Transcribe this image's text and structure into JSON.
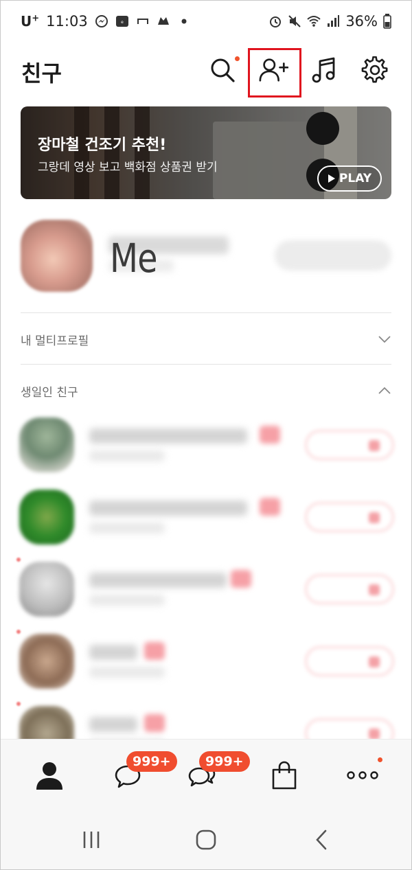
{
  "status_bar": {
    "carrier": "U",
    "carrier_sup": "+",
    "time": "11:03",
    "battery_percent": "36%",
    "icons_left": [
      "messenger-icon",
      "emart-icon",
      "screen-icon",
      "game-icon",
      "dot-icon"
    ],
    "icons_right": [
      "alarm-icon",
      "mute-icon",
      "wifi-icon",
      "signal-icon",
      "battery-icon"
    ]
  },
  "header": {
    "title": "친구",
    "icons": [
      "search-icon",
      "add-friend-icon",
      "music-icon",
      "settings-icon"
    ]
  },
  "banner": {
    "title": "장마철 건조기 추천!",
    "subtitle": "그랑데 영상 보고 백화점 상품권 받기",
    "play_label": "PLAY"
  },
  "profile": {
    "name_overlay": "Me"
  },
  "sections": {
    "multi_profile": "내 멀티프로필",
    "birthday_friends": "생일인 친구"
  },
  "tabbar": {
    "tabs": [
      "friends-tab",
      "chats-tab",
      "openchat-tab",
      "shopping-tab",
      "more-tab"
    ],
    "chats_badge": "999+",
    "openchat_badge": "999+"
  },
  "colors": {
    "accent_red": "#f04d2f",
    "highlight_box": "#e0141e"
  }
}
